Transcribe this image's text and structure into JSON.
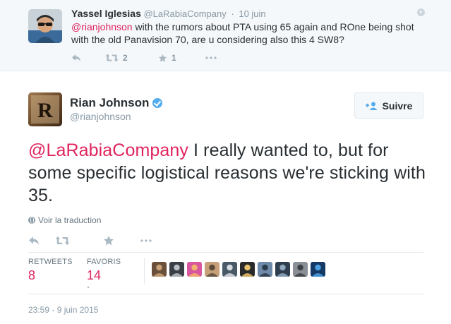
{
  "parent_tweet": {
    "name": "Yassel Iglesias",
    "handle": "@LaRabiaCompany",
    "separator": "·",
    "time": "10 juin",
    "mention": "@rianjohnson",
    "text": " with the rumors about PTA using 65 again and ROne being shot with the old Panavision 70, are u considering also this 4 SW8?",
    "actions": {
      "reply_icon": "reply-icon",
      "retweet_icon": "retweet-icon",
      "retweet_count": "2",
      "favorite_icon": "star-icon",
      "favorite_count": "1",
      "more_icon": "more-icon"
    }
  },
  "main_tweet": {
    "name": "Rian Johnson",
    "handle": "@rianjohnson",
    "verified_icon": "verified-badge-icon",
    "avatar_letter": "R",
    "follow_button": "Suivre",
    "follow_icon": "add-user-icon",
    "mention": "@LaRabiaCompany",
    "text": " I really wanted to, but for  some specific logistical reasons we're sticking with 35.",
    "translate_label": "Voir la traduction",
    "stats": {
      "retweets_label": "RETWEETS",
      "retweets_value": "8",
      "favorites_label": "FAVORIS",
      "favorites_value": "14"
    },
    "timestamp": "23:59 - 9 juin 2015"
  },
  "colors": {
    "accent_link": "#e0245e",
    "verified": "#55acee",
    "muted": "#8899a6",
    "text": "#292f33"
  },
  "favoriter_avatars": [
    {
      "name": "favoriter-avatar-1",
      "bg": "#6a4f3a",
      "fg": "#c9a27a"
    },
    {
      "name": "favoriter-avatar-2",
      "bg": "#3a3f45",
      "fg": "#b8bfc6"
    },
    {
      "name": "favoriter-avatar-3",
      "bg": "#d9579e",
      "fg": "#f2b36a"
    },
    {
      "name": "favoriter-avatar-4",
      "bg": "#c7a07a",
      "fg": "#5b4a3a"
    },
    {
      "name": "favoriter-avatar-5",
      "bg": "#4a5a66",
      "fg": "#d8dde2"
    },
    {
      "name": "favoriter-avatar-6",
      "bg": "#2a2a2a",
      "fg": "#e8c26a"
    },
    {
      "name": "favoriter-avatar-7",
      "bg": "#6e8aa8",
      "fg": "#2a3a4a"
    },
    {
      "name": "favoriter-avatar-8",
      "bg": "#2e3e4e",
      "fg": "#8fa8c0"
    },
    {
      "name": "favoriter-avatar-9",
      "bg": "#8a8f96",
      "fg": "#3a3f44"
    },
    {
      "name": "favoriter-avatar-10",
      "bg": "#143a66",
      "fg": "#4aa0e0"
    }
  ]
}
